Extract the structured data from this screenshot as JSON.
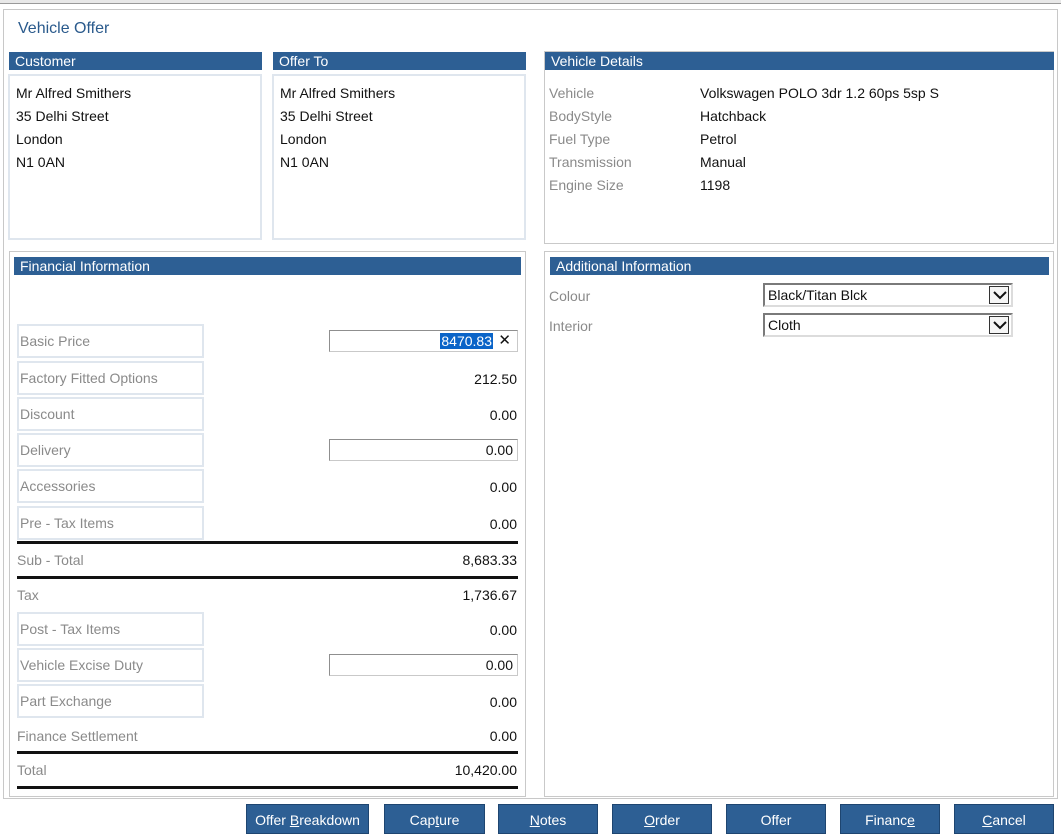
{
  "window_title": "Vehicle Offer",
  "customer": {
    "header": "Customer",
    "lines": [
      "Mr Alfred Smithers",
      "35 Delhi Street",
      "London",
      "N1 0AN"
    ]
  },
  "offer_to": {
    "header": "Offer To",
    "lines": [
      "Mr Alfred Smithers",
      "35 Delhi Street",
      "London",
      "N1 0AN"
    ]
  },
  "vehicle_details": {
    "header": "Vehicle Details",
    "rows": [
      {
        "label": "Vehicle",
        "value": "Volkswagen POLO 3dr 1.2 60ps 5sp S"
      },
      {
        "label": "BodyStyle",
        "value": "Hatchback"
      },
      {
        "label": "Fuel Type",
        "value": "Petrol"
      },
      {
        "label": "Transmission",
        "value": "Manual"
      },
      {
        "label": "Engine Size",
        "value": "1198"
      }
    ]
  },
  "financial": {
    "header": "Financial Information",
    "basic_price": {
      "label": "Basic Price",
      "value": "8470.83"
    },
    "factory_options": {
      "label": "Factory Fitted Options",
      "value": "212.50"
    },
    "discount": {
      "label": "Discount",
      "value": "0.00"
    },
    "delivery": {
      "label": "Delivery",
      "value": "0.00"
    },
    "accessories": {
      "label": "Accessories",
      "value": "0.00"
    },
    "pre_tax": {
      "label": "Pre - Tax Items",
      "value": "0.00"
    },
    "subtotal": {
      "label": "Sub - Total",
      "value": "8,683.33"
    },
    "tax": {
      "label": "Tax",
      "value": "1,736.67"
    },
    "post_tax": {
      "label": "Post - Tax Items",
      "value": "0.00"
    },
    "excise": {
      "label": "Vehicle Excise Duty",
      "value": "0.00"
    },
    "part_exchange": {
      "label": "Part Exchange",
      "value": "0.00"
    },
    "finance_settlement": {
      "label": "Finance Settlement",
      "value": "0.00"
    },
    "total": {
      "label": "Total",
      "value": "10,420.00"
    }
  },
  "additional": {
    "header": "Additional Information",
    "colour": {
      "label": "Colour",
      "value": "Black/Titan Blck"
    },
    "interior": {
      "label": "Interior",
      "value": "Cloth"
    }
  },
  "buttons": {
    "offer_breakdown": {
      "pre": "Offer ",
      "ul": "B",
      "post": "reakdown"
    },
    "capture": {
      "pre": "Cap",
      "ul": "t",
      "post": "ure"
    },
    "notes": {
      "pre": "",
      "ul": "N",
      "post": "otes"
    },
    "order": {
      "pre": "",
      "ul": "O",
      "post": "rder"
    },
    "offer": {
      "pre": "Offer",
      "ul": "",
      "post": ""
    },
    "finance": {
      "pre": "Financ",
      "ul": "e",
      "post": ""
    },
    "cancel": {
      "pre": "",
      "ul": "C",
      "post": "ancel"
    }
  },
  "colors": {
    "header_bg": "#2d5f94",
    "title": "#2a5a8c",
    "selection": "#0a64c8"
  }
}
